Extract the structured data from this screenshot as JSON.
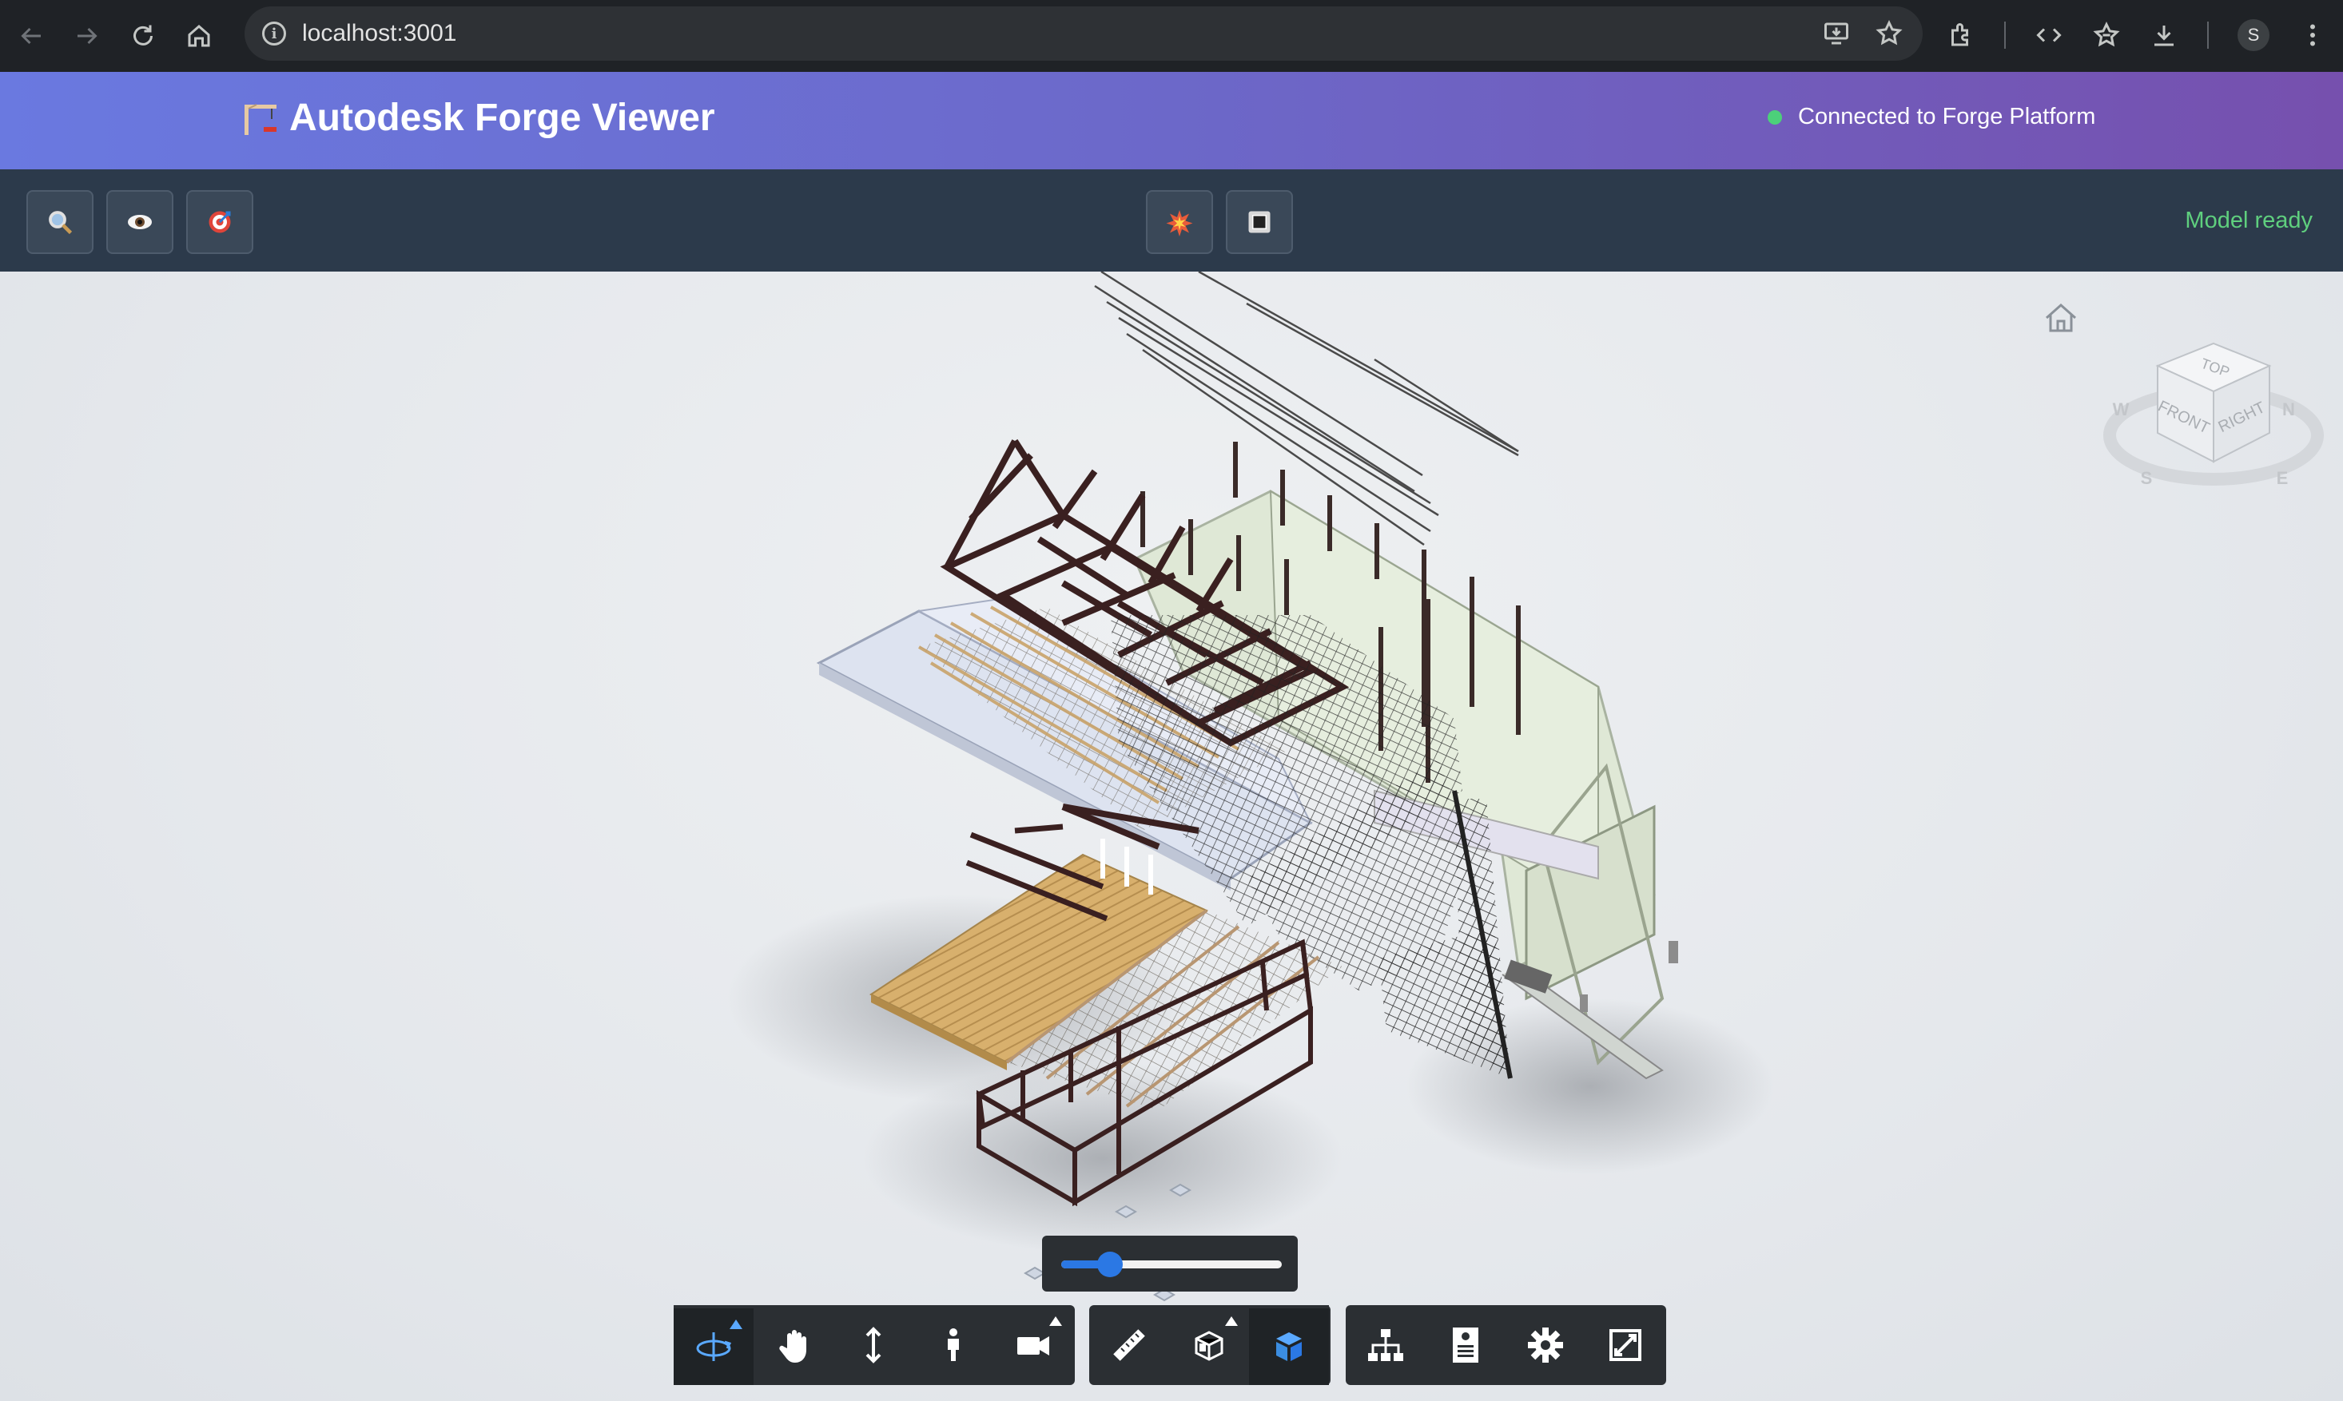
{
  "browser": {
    "url": "localhost:3001",
    "avatar_letter": "S"
  },
  "header": {
    "title": "Autodesk Forge Viewer",
    "connection_status": "Connected to Forge Platform",
    "connection_color": "#4cd07a",
    "gradient": [
      "#6a79e0",
      "#7650ae"
    ]
  },
  "toolbar": {
    "left_buttons": [
      "search-icon",
      "eye-icon",
      "target-icon"
    ],
    "center_buttons": [
      "explode-icon",
      "stop-icon"
    ],
    "status": "Model ready",
    "status_color": "#5fcf7e"
  },
  "viewer": {
    "viewcube": {
      "faces": [
        "TOP",
        "FRONT",
        "RIGHT"
      ],
      "compass": [
        "W",
        "N",
        "S",
        "E"
      ]
    },
    "explode_slider": {
      "value": 0.22
    },
    "navbar_groups": [
      [
        "orbit-icon",
        "pan-icon",
        "zoom-icon",
        "first-person-icon",
        "camera-icon"
      ],
      [
        "measure-icon",
        "section-icon",
        "model-cube-icon"
      ],
      [
        "model-browser-icon",
        "properties-icon",
        "settings-icon",
        "fullscreen-icon"
      ]
    ],
    "accent": "#2b78e4"
  }
}
